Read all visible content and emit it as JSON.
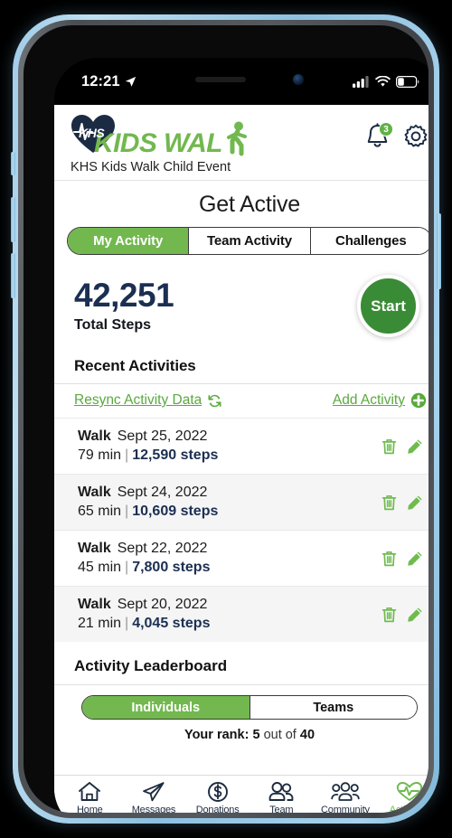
{
  "status_bar": {
    "time": "12:21",
    "location_icon": "location-arrow-icon",
    "signal_icon": "cellular-signal-icon",
    "wifi_icon": "wifi-icon",
    "battery_icon": "battery-icon"
  },
  "header": {
    "logo": {
      "badge_text": "KHS",
      "wordmark": "KIDS WAL",
      "heart_icon": "heart-ekg-logo-icon",
      "walker_icon": "walking-person-icon"
    },
    "event_name": "KHS Kids Walk Child Event",
    "notifications": {
      "icon": "bell-icon",
      "badge_count": "3"
    },
    "settings": {
      "icon": "gear-icon"
    }
  },
  "page": {
    "title": "Get Active"
  },
  "tabs": [
    {
      "label": "My Activity",
      "active": true
    },
    {
      "label": "Team Activity",
      "active": false
    },
    {
      "label": "Challenges",
      "active": false
    }
  ],
  "summary": {
    "total_steps_value": "42,251",
    "total_steps_label": "Total Steps",
    "start_button_label": "Start"
  },
  "recent": {
    "heading": "Recent Activities",
    "resync_label": "Resync Activity Data",
    "resync_icon": "refresh-icon",
    "add_label": "Add Activity",
    "add_icon": "plus-circle-icon",
    "row_icons": {
      "delete": "trash-icon",
      "edit": "pencil-icon"
    },
    "separator": "|",
    "activities": [
      {
        "type": "Walk",
        "date": "Sept 25, 2022",
        "duration": "79 min",
        "steps": "12,590 steps"
      },
      {
        "type": "Walk",
        "date": "Sept 24, 2022",
        "duration": "65 min",
        "steps": "10,609 steps"
      },
      {
        "type": "Walk",
        "date": "Sept 22, 2022",
        "duration": "45 min",
        "steps": "7,800 steps"
      },
      {
        "type": "Walk",
        "date": "Sept 20, 2022",
        "duration": "21 min",
        "steps": "4,045 steps"
      }
    ]
  },
  "leaderboard": {
    "heading": "Activity Leaderboard",
    "toggle": [
      {
        "label": "Individuals",
        "active": true
      },
      {
        "label": "Teams",
        "active": false
      }
    ],
    "rank_prefix": "Your rank:",
    "rank_value": "5",
    "rank_middle": "out of",
    "rank_total": "40"
  },
  "bottom_nav": [
    {
      "label": "Home",
      "icon": "home-icon",
      "active": false
    },
    {
      "label": "Messages",
      "icon": "paper-plane-icon",
      "active": false
    },
    {
      "label": "Donations",
      "icon": "dollar-circle-icon",
      "active": false
    },
    {
      "label": "Team",
      "icon": "two-people-icon",
      "active": false
    },
    {
      "label": "Community",
      "icon": "three-people-icon",
      "active": false
    },
    {
      "label": "Activityyy",
      "icon": "heart-pulse-icon",
      "active": true
    }
  ],
  "colors": {
    "brand_green": "#72b84f",
    "link_green": "#5aa93f",
    "start_green": "#3a8b35",
    "navy": "#1b2f52",
    "badge_green": "#5fb246"
  }
}
